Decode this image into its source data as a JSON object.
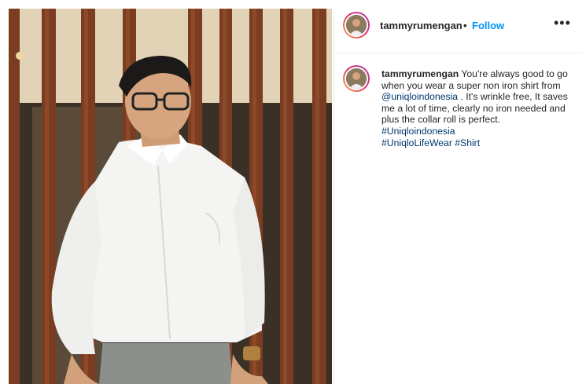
{
  "post": {
    "username": "tammyrumengan",
    "separator": "•",
    "follow_label": "Follow",
    "more_icon": "more-options-icon",
    "more_glyph": "•••"
  },
  "caption": {
    "username": "tammyrumengan",
    "text_1": "You're always good to go when you wear a super non iron shirt from",
    "mention": "@uniqloindonesia",
    "text_2": ". It's wrinkle free, It saves me a lot of time, clearly no iron needed and plus the collar roll is perfect.",
    "hashtag_1": "#Uniqloindonesia",
    "hashtag_2": "#UniqloLifeWear",
    "hashtag_3": "#Shirt"
  },
  "colors": {
    "link": "#0095f6",
    "hashtag": "#00376b",
    "text": "#262626",
    "border": "#efefef"
  }
}
